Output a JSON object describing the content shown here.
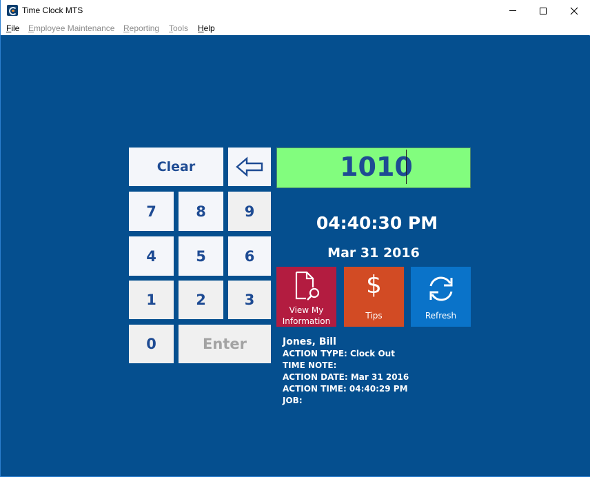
{
  "window": {
    "title": "Time Clock MTS",
    "controls": {
      "minimize": "minimize",
      "maximize": "maximize",
      "close": "close"
    }
  },
  "menu": {
    "items": [
      {
        "label": "File",
        "accel": "F",
        "rest": "ile",
        "enabled": true
      },
      {
        "label": "Employee Maintenance",
        "accel": "E",
        "rest": "mployee Maintenance",
        "enabled": false
      },
      {
        "label": "Reporting",
        "accel": "R",
        "rest": "eporting",
        "enabled": false
      },
      {
        "label": "Tools",
        "accel": "T",
        "rest": "ools",
        "enabled": false
      },
      {
        "label": "Help",
        "accel": "H",
        "rest": "elp",
        "enabled": true
      }
    ]
  },
  "keypad": {
    "clear": "Clear",
    "backspace_icon": "left-arrow-icon",
    "keys": [
      "7",
      "8",
      "9",
      "4",
      "5",
      "6",
      "1",
      "2",
      "3",
      "0"
    ],
    "enter": "Enter"
  },
  "pin": {
    "value": "1010"
  },
  "clock": {
    "time": "04:40:30 PM",
    "date": "Mar 31 2016"
  },
  "tiles": {
    "info": {
      "line1": "View My",
      "line2": "Information",
      "icon": "document-search-icon",
      "color": "#b31c40"
    },
    "tips": {
      "label": "Tips",
      "icon": "$",
      "color": "#d24b24"
    },
    "refresh": {
      "label": "Refresh",
      "icon": "refresh-icon",
      "color": "#0a73c9"
    }
  },
  "last_action": {
    "employee": "Jones, Bill",
    "action_type": "ACTION TYPE: Clock Out",
    "time_note": "TIME NOTE:",
    "action_date": "ACTION DATE: Mar 31 2016",
    "action_time": "ACTION TIME: 04:40:29 PM",
    "job": "JOB:"
  },
  "colors": {
    "background": "#054f8f",
    "pin_background": "#82fd7e",
    "key_text": "#1e4b93"
  }
}
